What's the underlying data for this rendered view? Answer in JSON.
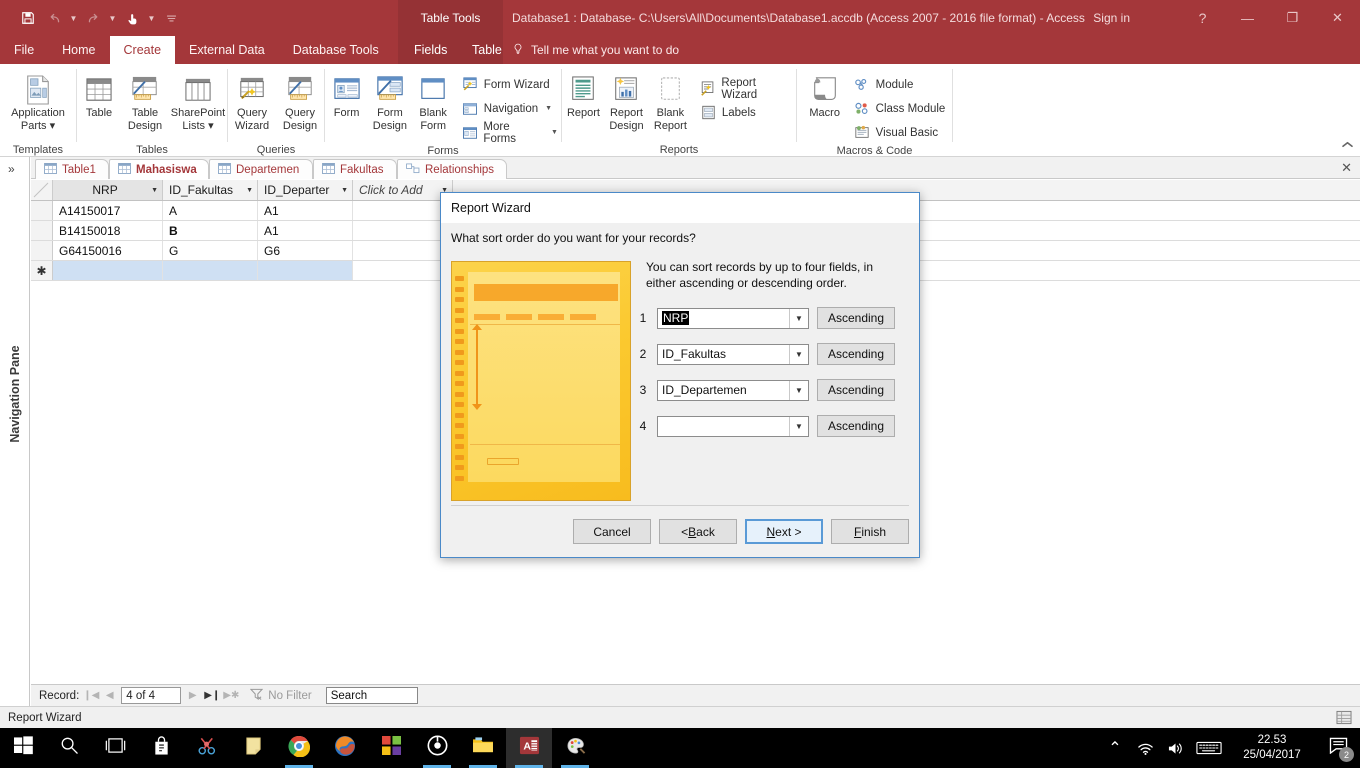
{
  "titlebar": {
    "qat": [
      {
        "name": "save-icon",
        "label": "Save",
        "glyph": "ὋE",
        "dim": false
      },
      {
        "name": "undo-icon",
        "label": "Undo",
        "glyph": "↶",
        "dim": true
      },
      {
        "name": "redo-icon",
        "label": "Redo",
        "glyph": "↷",
        "dim": true
      },
      {
        "name": "touch-mode-icon",
        "label": "Touch/Mouse Mode",
        "glyph": "☝",
        "dim": false
      },
      {
        "name": "customize-qat-icon",
        "label": "Customize Quick Access Toolbar",
        "glyph": "≡",
        "dim": true
      }
    ],
    "context_tool": "Table Tools",
    "document_title": "Database1 : Database- C:\\Users\\All\\Documents\\Database1.accdb (Access 2007 - 2016 file format)  -  Access",
    "signin": "Sign in",
    "help": "?",
    "minimize": "—",
    "restore": "❐",
    "close": "✕"
  },
  "ribbon_tabs": {
    "items": [
      {
        "label": "File",
        "active": false,
        "ctx": false
      },
      {
        "label": "Home",
        "active": false,
        "ctx": false
      },
      {
        "label": "Create",
        "active": true,
        "ctx": false
      },
      {
        "label": "External Data",
        "active": false,
        "ctx": false
      },
      {
        "label": "Database Tools",
        "active": false,
        "ctx": false
      },
      {
        "label": "Fields",
        "active": false,
        "ctx": true
      },
      {
        "label": "Table",
        "active": false,
        "ctx": true
      }
    ],
    "tellme": "Tell me what you want to do",
    "tellme_icon": "lightbulb-icon",
    "collapse_icon": "chevron-up-icon"
  },
  "ribbon_groups": [
    {
      "name": "templates",
      "label": "Templates",
      "big_buttons": [
        {
          "name": "application-parts-button",
          "line1": "Application",
          "line2": "Parts ▾",
          "icon": "application-parts-icon"
        }
      ],
      "small_buttons": []
    },
    {
      "name": "tables",
      "label": "Tables",
      "big_buttons": [
        {
          "name": "table-button",
          "line1": "Table",
          "line2": "",
          "icon": "table-icon"
        },
        {
          "name": "table-design-button",
          "line1": "Table",
          "line2": "Design",
          "icon": "table-design-icon"
        },
        {
          "name": "sharepoint-lists-button",
          "line1": "SharePoint",
          "line2": "Lists ▾",
          "icon": "sharepoint-lists-icon"
        }
      ],
      "small_buttons": []
    },
    {
      "name": "queries",
      "label": "Queries",
      "big_buttons": [
        {
          "name": "query-wizard-button",
          "line1": "Query",
          "line2": "Wizard",
          "icon": "query-wizard-icon"
        },
        {
          "name": "query-design-button",
          "line1": "Query",
          "line2": "Design",
          "icon": "query-design-icon"
        }
      ],
      "small_buttons": []
    },
    {
      "name": "forms",
      "label": "Forms",
      "big_buttons": [
        {
          "name": "form-button",
          "line1": "Form",
          "line2": "",
          "icon": "form-icon"
        },
        {
          "name": "form-design-button",
          "line1": "Form",
          "line2": "Design",
          "icon": "form-design-icon"
        },
        {
          "name": "blank-form-button",
          "line1": "Blank",
          "line2": "Form",
          "icon": "blank-form-icon"
        }
      ],
      "small_buttons": [
        {
          "name": "form-wizard-button",
          "label": "Form Wizard",
          "icon": "form-wizard-icon",
          "caret": false
        },
        {
          "name": "navigation-button",
          "label": "Navigation",
          "icon": "navigation-icon",
          "caret": true
        },
        {
          "name": "more-forms-button",
          "label": "More Forms",
          "icon": "more-forms-icon",
          "caret": true
        }
      ]
    },
    {
      "name": "reports",
      "label": "Reports",
      "big_buttons": [
        {
          "name": "report-button",
          "line1": "Report",
          "line2": "",
          "icon": "report-icon"
        },
        {
          "name": "report-design-button",
          "line1": "Report",
          "line2": "Design",
          "icon": "report-design-icon"
        },
        {
          "name": "blank-report-button",
          "line1": "Blank",
          "line2": "Report",
          "icon": "blank-report-icon"
        }
      ],
      "small_buttons": [
        {
          "name": "report-wizard-button",
          "label": "Report Wizard",
          "icon": "report-wizard-icon",
          "caret": false
        },
        {
          "name": "labels-button",
          "label": "Labels",
          "icon": "labels-icon",
          "caret": false
        }
      ]
    },
    {
      "name": "macros-and-code",
      "label": "Macros & Code",
      "big_buttons": [
        {
          "name": "macro-button",
          "line1": "Macro",
          "line2": "",
          "icon": "macro-icon"
        }
      ],
      "small_buttons": [
        {
          "name": "module-button",
          "label": "Module",
          "icon": "module-icon",
          "caret": false
        },
        {
          "name": "class-module-button",
          "label": "Class Module",
          "icon": "class-module-icon",
          "caret": false
        },
        {
          "name": "visual-basic-button",
          "label": "Visual Basic",
          "icon": "visual-basic-icon",
          "caret": false
        }
      ]
    }
  ],
  "navpane": {
    "expand_icon": "»",
    "label": "Navigation Pane"
  },
  "doctabs": {
    "items": [
      {
        "label": "Table1",
        "active": false
      },
      {
        "label": "Mahasiswa",
        "active": true
      },
      {
        "label": "Departemen",
        "active": false
      },
      {
        "label": "Fakultas",
        "active": false
      },
      {
        "label": "Relationships",
        "active": false
      }
    ],
    "close_icon": "✕"
  },
  "datasheet": {
    "columns": [
      {
        "label": "NRP",
        "selected": true
      },
      {
        "label": "ID_Fakultas",
        "selected": false
      },
      {
        "label": "ID_Departer",
        "selected": false
      },
      {
        "label": "Click to Add",
        "selected": false
      }
    ],
    "rows": [
      {
        "selector": "",
        "cells": [
          "A14150017",
          "A",
          "A1",
          ""
        ]
      },
      {
        "selector": "",
        "cells": [
          "B14150018",
          "B",
          "A1",
          ""
        ]
      },
      {
        "selector": "",
        "cells": [
          "G64150016",
          "G",
          "G6",
          ""
        ]
      },
      {
        "selector": "✱",
        "cells": [
          "",
          "",
          "",
          ""
        ]
      }
    ]
  },
  "navbar": {
    "record_label": "Record:",
    "first_icon": "❙◀",
    "prev_icon": "◀",
    "record_value": "4 of 4",
    "next_icon": "▶",
    "last_icon": "▶❙",
    "newrec_icon": "▶✱",
    "filter_icon": "no-filter-icon",
    "filter_label": "No Filter",
    "search_placeholder": "Search",
    "search_value": "Search"
  },
  "statusbar": {
    "text": "Report Wizard",
    "view_icons": [
      "datasheet-view-icon"
    ]
  },
  "dialog": {
    "title": "Report Wizard",
    "question": "What sort order do you want for your records?",
    "description": "You can sort records by up to four fields, in either ascending or descending order.",
    "image_name": "report-sort-illustration",
    "sort_rows": [
      {
        "num": "1",
        "value": "NRP",
        "selected": true,
        "order": "Ascending"
      },
      {
        "num": "2",
        "value": "ID_Fakultas",
        "selected": false,
        "order": "Ascending"
      },
      {
        "num": "3",
        "value": "ID_Departemen",
        "selected": false,
        "order": "Ascending"
      },
      {
        "num": "4",
        "value": "",
        "selected": false,
        "order": "Ascending"
      }
    ],
    "buttons": [
      {
        "name": "cancel-button",
        "pre": "Cancel",
        "acc": "",
        "post": "",
        "default": false
      },
      {
        "name": "back-button",
        "pre": "< ",
        "acc": "B",
        "post": "ack",
        "default": false
      },
      {
        "name": "next-button",
        "pre": "",
        "acc": "N",
        "post": "ext >",
        "default": true
      },
      {
        "name": "finish-button",
        "pre": "",
        "acc": "F",
        "post": "inish",
        "default": false
      }
    ]
  },
  "taskbar": {
    "items": [
      {
        "name": "start-button",
        "icon": "windows-logo-icon",
        "active": false,
        "running": false
      },
      {
        "name": "search-button",
        "icon": "search-icon",
        "active": false,
        "running": false
      },
      {
        "name": "task-view-button",
        "icon": "task-view-icon",
        "active": false,
        "running": false
      },
      {
        "name": "store-button",
        "icon": "store-icon",
        "active": false,
        "running": false
      },
      {
        "name": "snip-button",
        "icon": "snipping-tool-icon",
        "active": false,
        "running": false
      },
      {
        "name": "sticky-notes-button",
        "icon": "sticky-notes-icon",
        "active": false,
        "running": false
      },
      {
        "name": "chrome-button",
        "icon": "chrome-icon",
        "active": false,
        "running": true
      },
      {
        "name": "firefox-button",
        "icon": "firefox-icon",
        "active": false,
        "running": false
      },
      {
        "name": "ms-office-button",
        "icon": "microsoft-squares-icon",
        "active": false,
        "running": false
      },
      {
        "name": "media-button",
        "icon": "media-player-icon",
        "active": false,
        "running": true
      },
      {
        "name": "file-explorer-button",
        "icon": "folder-icon",
        "active": false,
        "running": true
      },
      {
        "name": "access-button",
        "icon": "access-icon",
        "active": true,
        "running": true
      },
      {
        "name": "paint-button",
        "icon": "paint-icon",
        "active": false,
        "running": true
      }
    ],
    "tray": {
      "show_hidden_icon": "⌃",
      "network_icon": "wifi-icon",
      "volume_icon": "speaker-icon",
      "keyboard_icon": "keyboard-icon",
      "time": "22.53",
      "date": "25/04/2017",
      "notification_icon": "action-center-icon",
      "notification_count": "2"
    }
  },
  "colors": {
    "accent": "#a4373a",
    "ribbon_ctx": "#953235",
    "dialog_border": "#4a89c8",
    "selection": "#cfe0f3",
    "taskbar": "#000000"
  }
}
